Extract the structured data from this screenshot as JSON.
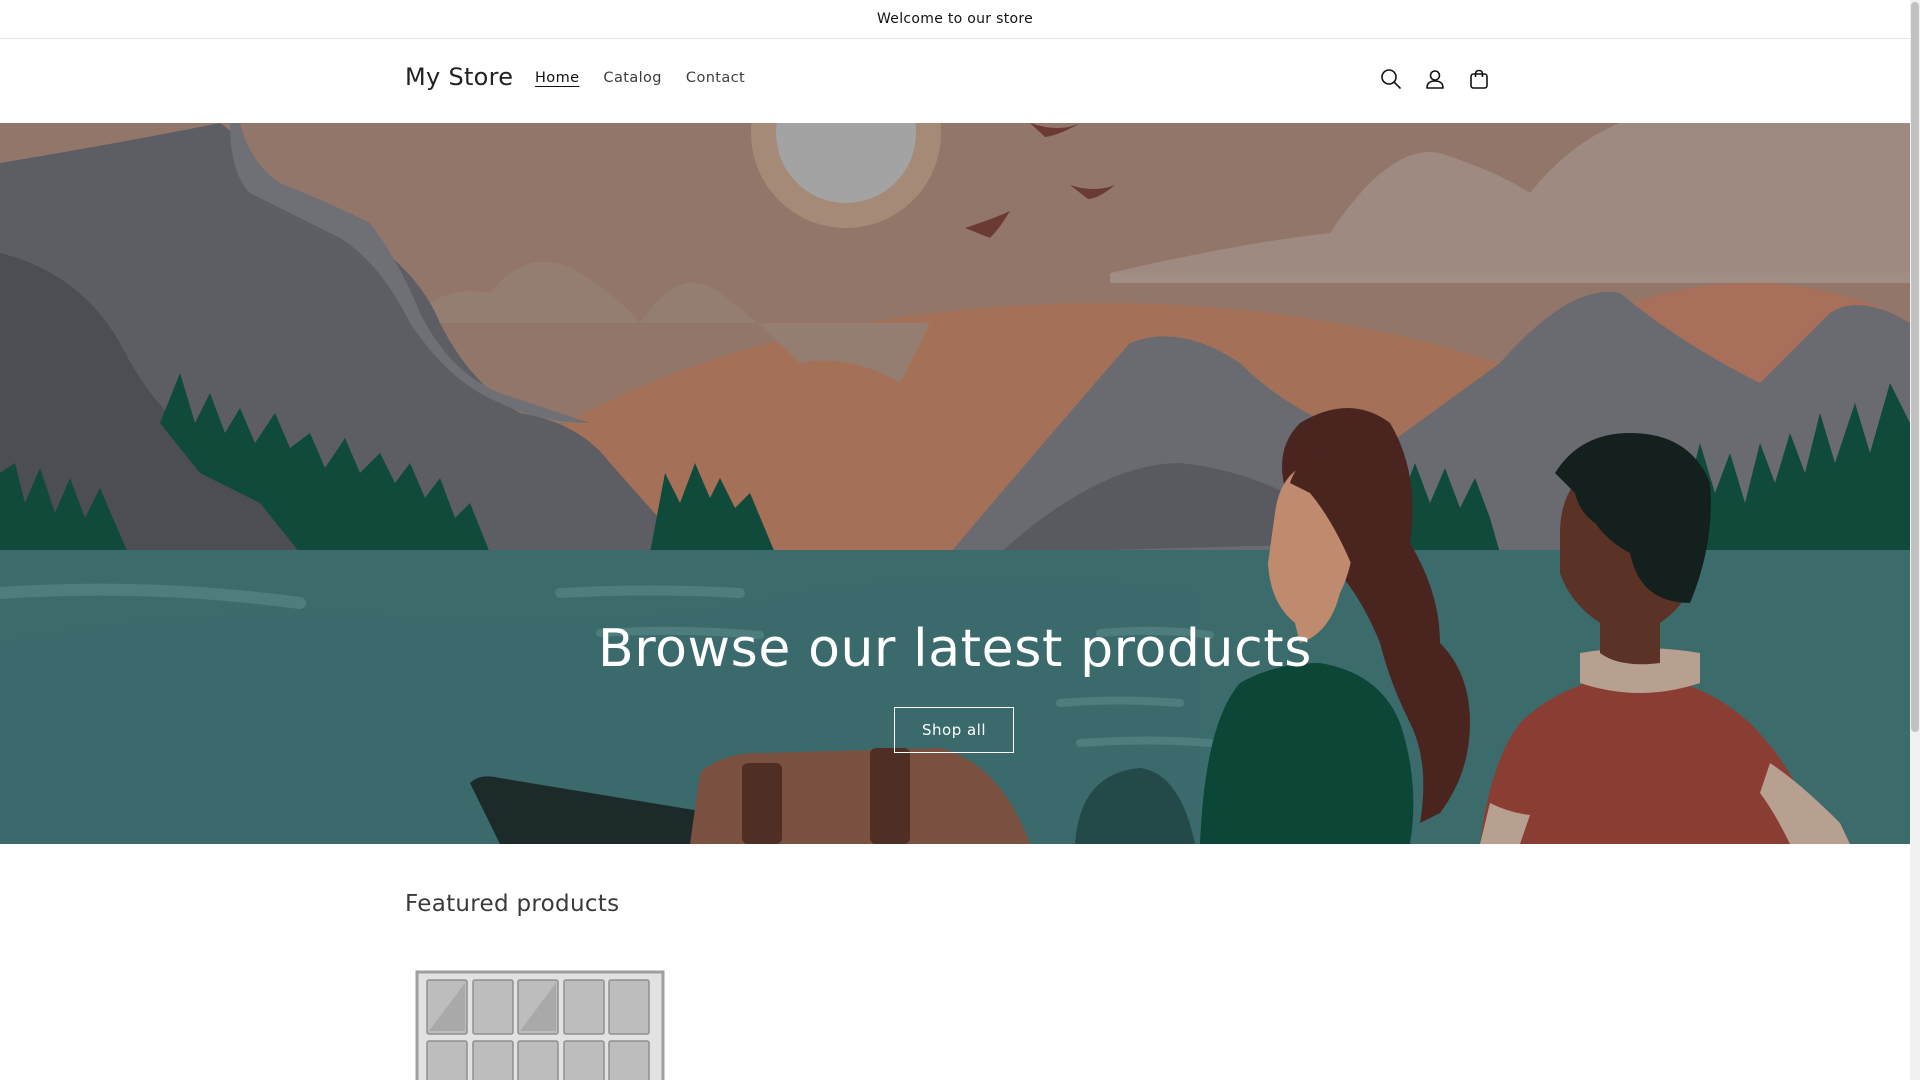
{
  "announcement": {
    "text": "Welcome to our store"
  },
  "header": {
    "logo": "My Store",
    "nav": [
      {
        "label": "Home",
        "active": true
      },
      {
        "label": "Catalog",
        "active": false
      },
      {
        "label": "Contact",
        "active": false
      }
    ],
    "icons": [
      "search-icon",
      "account-icon",
      "cart-icon"
    ]
  },
  "hero": {
    "title": "Browse our latest products",
    "button_label": "Shop all"
  },
  "featured": {
    "heading": "Featured products"
  },
  "colors": {
    "sky": "#8f7360",
    "water": "#3c6b6c",
    "mountain_gray": "#5c5e63",
    "tree_green": "#0f4a3a",
    "sun": "#a3a3a3"
  }
}
